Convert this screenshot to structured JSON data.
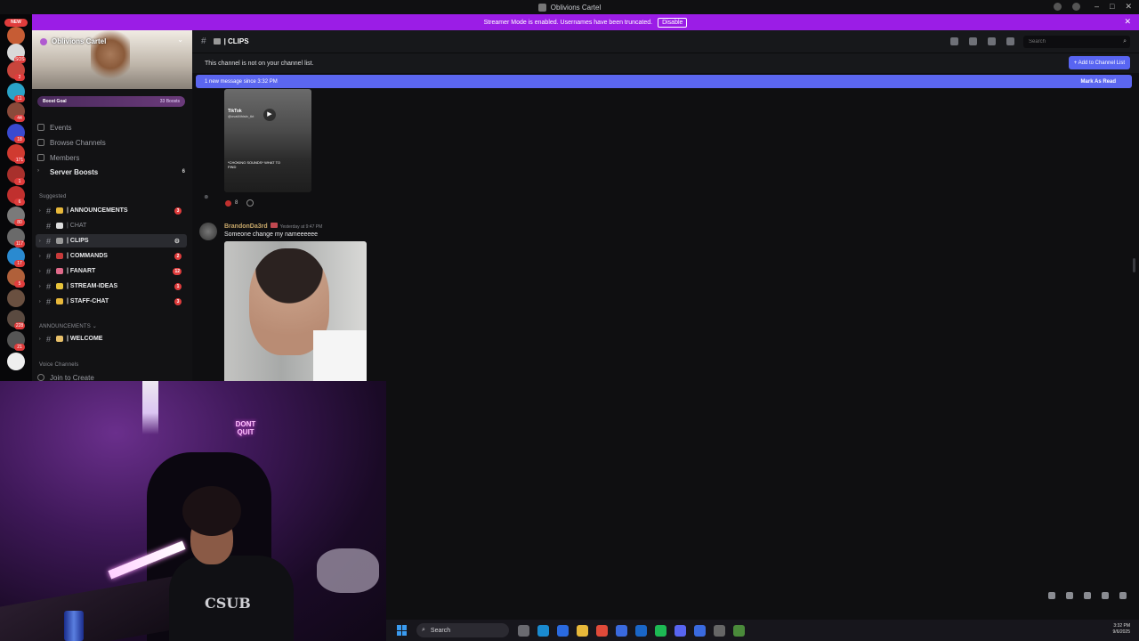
{
  "window": {
    "title": "Oblivions Cartel",
    "controls": [
      "–",
      "□",
      "✕"
    ]
  },
  "banner": {
    "text": "Streamer Mode is enabled. Usernames have been truncated.",
    "disable_label": "Disable",
    "close": "✕"
  },
  "rail": {
    "new_label": "NEW",
    "servers": [
      {
        "color": "#c65c34",
        "badge": ""
      },
      {
        "color": "#d9d9d9",
        "badge": "SOS"
      },
      {
        "color": "#c8453c",
        "badge": "2"
      },
      {
        "color": "#2aa3c8",
        "badge": "11"
      },
      {
        "color": "#8a4a3a",
        "badge": "44"
      },
      {
        "color": "#3a4ad0",
        "badge": "18"
      },
      {
        "color": "#d03a30",
        "badge": "171"
      },
      {
        "color": "#a8302c",
        "badge": "1"
      },
      {
        "color": "#c0302e",
        "badge": "6"
      },
      {
        "color": "#7a7a7a",
        "badge": "80"
      },
      {
        "color": "#6a6a6a",
        "badge": "117"
      },
      {
        "color": "#2a8ad0",
        "badge": "17"
      },
      {
        "color": "#b0603a",
        "badge": "5"
      },
      {
        "color": "#6a5040",
        "badge": ""
      },
      {
        "color": "#5a4a40",
        "badge": "228"
      },
      {
        "color": "#555555",
        "badge": "21"
      },
      {
        "color": "#eeeeee",
        "badge": ""
      }
    ]
  },
  "server": {
    "name": "Oblivions Cartel",
    "boost_goal": "Boost Goal",
    "boost_count": "33 Boosts"
  },
  "nav": {
    "events": "Events",
    "browse": "Browse Channels",
    "members": "Members",
    "server_boosts": "Server Boosts",
    "server_boosts_count": "6"
  },
  "categories": {
    "suggested": "Suggested",
    "announcements": "ANNOUNCEMENTS",
    "voice": "Voice Channels"
  },
  "channels": [
    {
      "name": "| ANNOUNCEMENTS",
      "badge": "3",
      "emo": "#e8b83a",
      "state": "unread"
    },
    {
      "name": "| CHAT",
      "badge": "",
      "emo": "#dddddd",
      "state": "muted"
    },
    {
      "name": "| CLIPS",
      "badge": "",
      "emo": "#999999",
      "state": "active"
    },
    {
      "name": "| COMMANDS",
      "badge": "2",
      "emo": "#c83a3a",
      "state": "unread"
    },
    {
      "name": "| FANART",
      "badge": "12",
      "emo": "#e06a8a",
      "state": "unread"
    },
    {
      "name": "| STREAM-IDEAS",
      "badge": "1",
      "emo": "#e8c43a",
      "state": "unread"
    },
    {
      "name": "| STAFF-CHAT",
      "badge": "3",
      "emo": "#e8b83a",
      "state": "unread"
    }
  ],
  "welcome_channel": {
    "name": "| WELCOME",
    "emo": "#e8c06a"
  },
  "voice": {
    "join": "Join to Create"
  },
  "header": {
    "channel": "| CLIPS",
    "search_placeholder": "Search"
  },
  "notice": {
    "text": "This channel is not on your channel list.",
    "add_button": "+ Add to Channel List"
  },
  "new_messages": {
    "text": "1 new message since 3:32 PM",
    "mark_read": "Mark As Read"
  },
  "message1": {
    "tiktok_label": "TikTok",
    "tiktok_handle": "@oval4thistv_tkt",
    "caption": "*CHOKING SOUNDS* WHAT TO FIND",
    "reaction_count": "8"
  },
  "message2": {
    "author": "BrandonDa3rd",
    "timestamp": "Yesterday at 9:47 PM",
    "text": "Someone change my nameeeeee"
  },
  "webcam": {
    "neon_text": "DONT QUIT",
    "shirt_text": "CSUB"
  },
  "taskbar": {
    "search": "Search",
    "time": "3:32 PM",
    "date": "9/6/2025",
    "apps": [
      "#6a6a70",
      "#1a8ad0",
      "#2a6ae0",
      "#e8b83a",
      "#e04a3a",
      "#3a6ae0",
      "#1a66c8",
      "#1db954",
      "#5865f2",
      "#3a6ae0",
      "#666666",
      "#4a8a3a"
    ]
  }
}
